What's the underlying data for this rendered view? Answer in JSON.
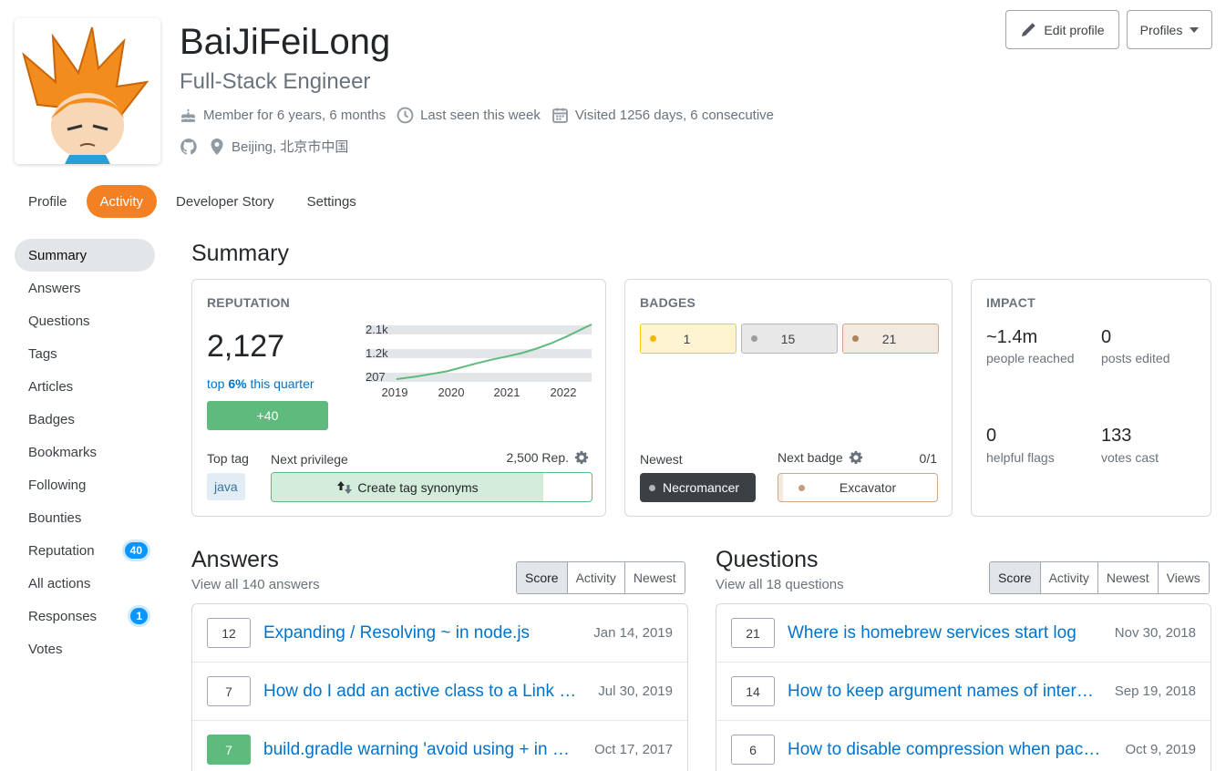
{
  "user": {
    "name": "BaiJiFeiLong",
    "title": "Full-Stack Engineer",
    "member_for": "Member for 6 years, 6 months",
    "last_seen": "Last seen this week",
    "visited": "Visited 1256 days, 6 consecutive",
    "location": "Beijing, 北京市中国"
  },
  "header_buttons": {
    "edit_profile": "Edit profile",
    "profiles": "Profiles"
  },
  "tabs": [
    {
      "label": "Profile",
      "active": false
    },
    {
      "label": "Activity",
      "active": true
    },
    {
      "label": "Developer Story",
      "active": false
    },
    {
      "label": "Settings",
      "active": false
    }
  ],
  "sidebar": {
    "items": [
      {
        "label": "Summary",
        "active": true
      },
      {
        "label": "Answers"
      },
      {
        "label": "Questions"
      },
      {
        "label": "Tags"
      },
      {
        "label": "Articles"
      },
      {
        "label": "Badges"
      },
      {
        "label": "Bookmarks"
      },
      {
        "label": "Following"
      },
      {
        "label": "Bounties"
      },
      {
        "label": "Reputation",
        "badge": "40"
      },
      {
        "label": "All actions"
      },
      {
        "label": "Responses",
        "badge": "1"
      },
      {
        "label": "Votes"
      }
    ]
  },
  "summary": {
    "heading": "Summary",
    "reputation": {
      "head": "REPUTATION",
      "value": "2,127",
      "top_pre": "top ",
      "top_pct": "6%",
      "top_post": " this quarter",
      "gain": "+40",
      "top_tag_label": "Top tag",
      "top_tag": "java",
      "next_privilege_label": "Next privilege",
      "next_privilege_amount": "2,500 Rep.",
      "next_privilege": "Create tag synonyms",
      "privilege_progress": 0.85
    },
    "badges": {
      "head": "BADGES",
      "gold": "1",
      "silver": "15",
      "bronze": "21",
      "newest_label": "Newest",
      "newest": "Necromancer",
      "next_label": "Next badge",
      "next_count": "0/1",
      "next": "Excavator"
    },
    "impact": {
      "head": "IMPACT",
      "reached": "~1.4m",
      "reached_label": "people reached",
      "edited": "0",
      "edited_label": "posts edited",
      "flags": "0",
      "flags_label": "helpful flags",
      "votes": "133",
      "votes_label": "votes cast"
    }
  },
  "chart_data": {
    "type": "line",
    "y_ticks": [
      "2.1k",
      "1.2k",
      "207"
    ],
    "x_ticks": [
      "2019",
      "2020",
      "2021",
      "2022"
    ],
    "ylim": [
      207,
      2127
    ],
    "series": [
      {
        "x": [
          2018.6,
          2019.0,
          2019.3,
          2019.6,
          2019.9,
          2020.2,
          2020.5,
          2020.8,
          2021.1,
          2021.4,
          2021.7,
          2022.0,
          2022.3,
          2022.5
        ],
        "values": [
          207,
          300,
          390,
          480,
          620,
          760,
          890,
          1000,
          1120,
          1280,
          1470,
          1700,
          1960,
          2127
        ]
      }
    ],
    "colors": {
      "line": "#5eba7d",
      "band": "#e3e6e8"
    }
  },
  "answers": {
    "heading": "Answers",
    "sub": "View all 140 answers",
    "sort": [
      {
        "label": "Score",
        "active": true
      },
      {
        "label": "Activity"
      },
      {
        "label": "Newest"
      }
    ],
    "rows": [
      {
        "score": "12",
        "title": "Expanding / Resolving ~ in node.js",
        "date": "Jan 14, 2019",
        "accepted": false
      },
      {
        "score": "7",
        "title": "How do I add an active class to a Link from React Router?",
        "date": "Jul 30, 2019",
        "accepted": false
      },
      {
        "score": "7",
        "title": "build.gradle warning 'avoid using + in version numbers'",
        "date": "Oct 17, 2017",
        "accepted": true
      }
    ]
  },
  "questions": {
    "heading": "Questions",
    "sub": "View all 18 questions",
    "sort": [
      {
        "label": "Score",
        "active": true
      },
      {
        "label": "Activity"
      },
      {
        "label": "Newest"
      },
      {
        "label": "Views"
      }
    ],
    "rows": [
      {
        "score": "21",
        "title": "Where is homebrew services start log",
        "date": "Nov 30, 2018"
      },
      {
        "score": "14",
        "title": "How to keep argument names of interface after compilation in Java?",
        "date": "Sep 19, 2018"
      },
      {
        "score": "6",
        "title": "How to disable compression when packing a spring boot app",
        "date": "Oct 9, 2019"
      }
    ]
  }
}
